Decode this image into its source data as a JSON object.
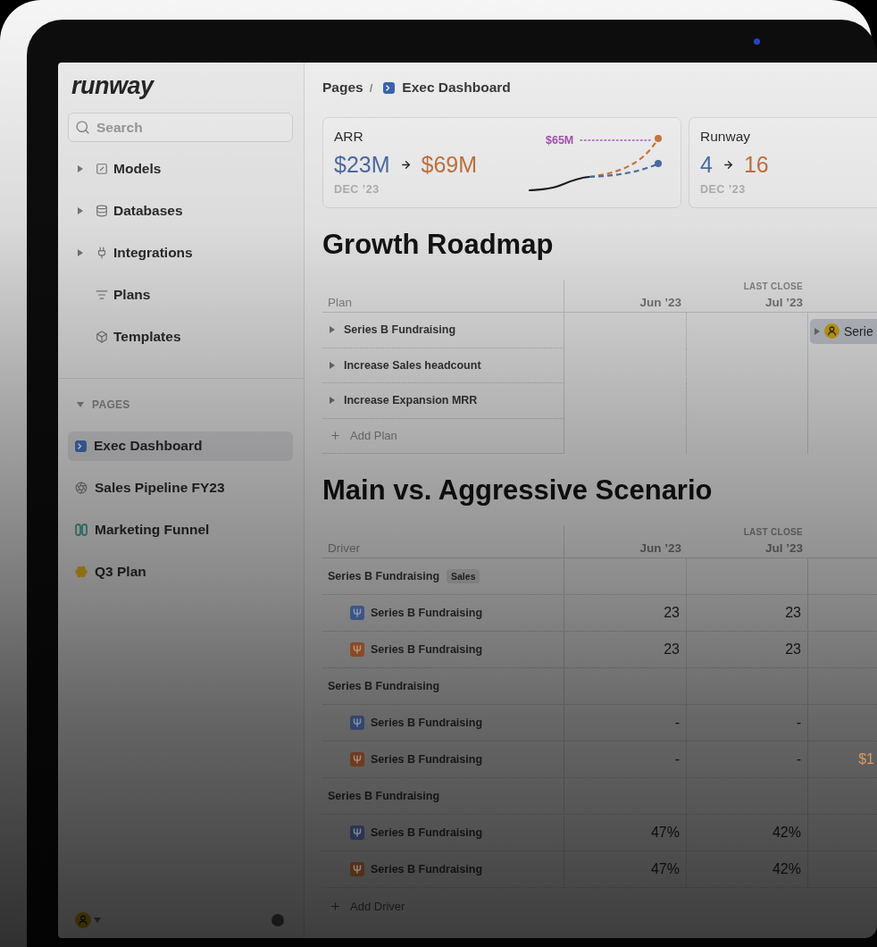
{
  "sidebar": {
    "logo": "runway",
    "search": {
      "placeholder": "Search"
    },
    "nav_items": [
      {
        "label": "Models",
        "expandable": true
      },
      {
        "label": "Databases",
        "expandable": true
      },
      {
        "label": "Integrations",
        "expandable": true
      },
      {
        "label": "Plans",
        "expandable": false
      },
      {
        "label": "Templates",
        "expandable": false
      }
    ],
    "pages_section": {
      "label": "PAGES",
      "expanded": true
    },
    "pages": [
      {
        "label": "Exec Dashboard",
        "selected": true,
        "color": "#34538a"
      },
      {
        "label": "Sales Pipeline FY23",
        "selected": false,
        "color": "#5e5e5e"
      },
      {
        "label": "Marketing Funnel",
        "selected": false,
        "color": "#2f6a62"
      },
      {
        "label": "Q3 Plan",
        "selected": false,
        "color": "#8c7012"
      }
    ]
  },
  "breadcrumb": {
    "separator": "/",
    "items": [
      {
        "label": "Pages"
      },
      {
        "label": "Exec Dashboard"
      }
    ]
  },
  "metrics": [
    {
      "label": "ARR",
      "start": "$23M",
      "target": "$69M",
      "period": "DEC ’23",
      "sparkline": {
        "target_label": "$65M"
      }
    },
    {
      "label": "Runway",
      "start": "4",
      "target": "16",
      "period": "DEC ’23"
    }
  ],
  "roadmap": {
    "title": "Growth Roadmap",
    "columns": [
      {
        "label": "Plan"
      },
      {
        "label": "Jun ’23"
      },
      {
        "label": "Jul ’23",
        "note": "LAST CLOSE"
      }
    ],
    "plans": [
      {
        "name": "Series B Fundraising",
        "expanded": false,
        "bar": "Serie"
      },
      {
        "name": "Increase Sales headcount",
        "expanded": false
      },
      {
        "name": "Increase Expansion MRR",
        "expanded": false
      }
    ],
    "add_label": "Add Plan"
  },
  "scenario": {
    "title": "Main vs. Aggressive Scenario",
    "columns": [
      {
        "label": "Driver"
      },
      {
        "label": "Jun ’23"
      },
      {
        "label": "Jul ’23",
        "note": "LAST CLOSE"
      }
    ],
    "groups": [
      {
        "name": "Series B Fundraising",
        "tag": "Sales",
        "rows": [
          {
            "name": "Series B Fundraising",
            "color": "#3d5585",
            "values": [
              "23",
              "23"
            ]
          },
          {
            "name": "Series B Fundraising",
            "color": "#8a4a28",
            "values": [
              "23",
              "23"
            ]
          }
        ]
      },
      {
        "name": "Series B Fundraising",
        "rows": [
          {
            "name": "Series B Fundraising",
            "color": "#34466c",
            "values": [
              "-",
              "-"
            ]
          },
          {
            "name": "Series B Fundraising",
            "color": "#6e3c20",
            "values": [
              "-",
              "-",
              "$1"
            ]
          }
        ]
      },
      {
        "name": "Series B Fundraising",
        "rows": [
          {
            "name": "Series B Fundraising",
            "color": "#2a3552",
            "values": [
              "47%",
              "42%"
            ]
          },
          {
            "name": "Series B Fundraising",
            "color": "#53301a",
            "values": [
              "47%",
              "42%"
            ]
          }
        ]
      }
    ],
    "add_label": "Add Driver"
  }
}
